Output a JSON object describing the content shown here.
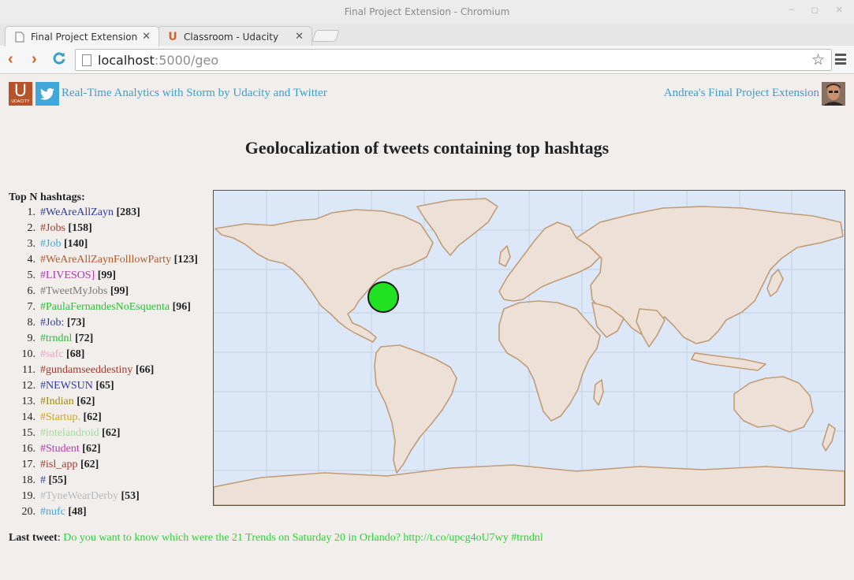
{
  "window": {
    "title": "Final Project Extension - Chromium",
    "controls": [
      "–",
      "◻",
      "✕"
    ]
  },
  "tabs": [
    {
      "label": "Final Project Extension",
      "active": true
    },
    {
      "label": "Classroom - Udacity",
      "active": false
    }
  ],
  "address": {
    "host": "localhost",
    "path": ":5000/geo"
  },
  "header": {
    "udacity_logo_letter": "U",
    "udacity_logo_text": "UDACITY",
    "left_link": "Real-Time Analytics with Storm by Udacity and Twitter",
    "right_link": "Andrea's Final Project Extension"
  },
  "page_title": "Geolocalization of tweets containing top hashtags",
  "hashtags": {
    "heading": "Top N hashtags:",
    "items": [
      {
        "num": "1.",
        "tag": "#WeAreAllZayn",
        "count": "[283]",
        "color": "#2e3b9c"
      },
      {
        "num": "2.",
        "tag": "#Jobs",
        "count": "[158]",
        "color": "#a03a2c"
      },
      {
        "num": "3.",
        "tag": "#Job",
        "count": "[140]",
        "color": "#3fa8d8"
      },
      {
        "num": "4.",
        "tag": "#WeAreAllZaynFolllowParty",
        "count": "[123]",
        "color": "#b05a2a"
      },
      {
        "num": "5.",
        "tag": "#LIVESOS]",
        "count": "[99]",
        "color": "#b535b5"
      },
      {
        "num": "6.",
        "tag": "#TweetMyJobs",
        "count": "[99]",
        "color": "#7a7a7a"
      },
      {
        "num": "7.",
        "tag": "#PaulaFernandesNoEsquenta",
        "count": "[96]",
        "color": "#2bbf35"
      },
      {
        "num": "8.",
        "tag": "#Job:",
        "count": "[73]",
        "color": "#2e3b9c"
      },
      {
        "num": "9.",
        "tag": "#trndnl",
        "count": "[72]",
        "color": "#2bbf35"
      },
      {
        "num": "10.",
        "tag": "#safc",
        "count": "[68]",
        "color": "#f0a0c8"
      },
      {
        "num": "11.",
        "tag": "#gundamseeddestiny",
        "count": "[66]",
        "color": "#a03a2c"
      },
      {
        "num": "12.",
        "tag": "#NEWSUN",
        "count": "[65]",
        "color": "#2e3b9c"
      },
      {
        "num": "13.",
        "tag": "#Indian",
        "count": "[62]",
        "color": "#9a8a15"
      },
      {
        "num": "14.",
        "tag": "#Startup.",
        "count": "[62]",
        "color": "#d4a020"
      },
      {
        "num": "15.",
        "tag": "#intelandroid",
        "count": "[62]",
        "color": "#9fdc9f"
      },
      {
        "num": "16.",
        "tag": "#Student",
        "count": "[62]",
        "color": "#b535b5"
      },
      {
        "num": "17.",
        "tag": "#isl_app",
        "count": "[62]",
        "color": "#a03a2c"
      },
      {
        "num": "18.",
        "tag": "#",
        "count": "[55]",
        "color": "#2e3b9c"
      },
      {
        "num": "19.",
        "tag": "#TyneWearDerby",
        "count": "[53]",
        "color": "#b8b8b8"
      },
      {
        "num": "20.",
        "tag": "#nufc",
        "count": "[48]",
        "color": "#3fa8d8"
      }
    ]
  },
  "map": {
    "marker_color": "#22e022",
    "marker_location": "Orlando"
  },
  "last_tweet": {
    "label": "Last tweet",
    "text": "Do you want to know which were the 21 Trends on Saturday 20 in Orlando? http://t.co/upcg4oU7wy #trndnl"
  },
  "colors": {
    "link": "#3b9fc9",
    "nav_arrows": "#d3622b",
    "tweet_text": "#2fcf3b"
  }
}
